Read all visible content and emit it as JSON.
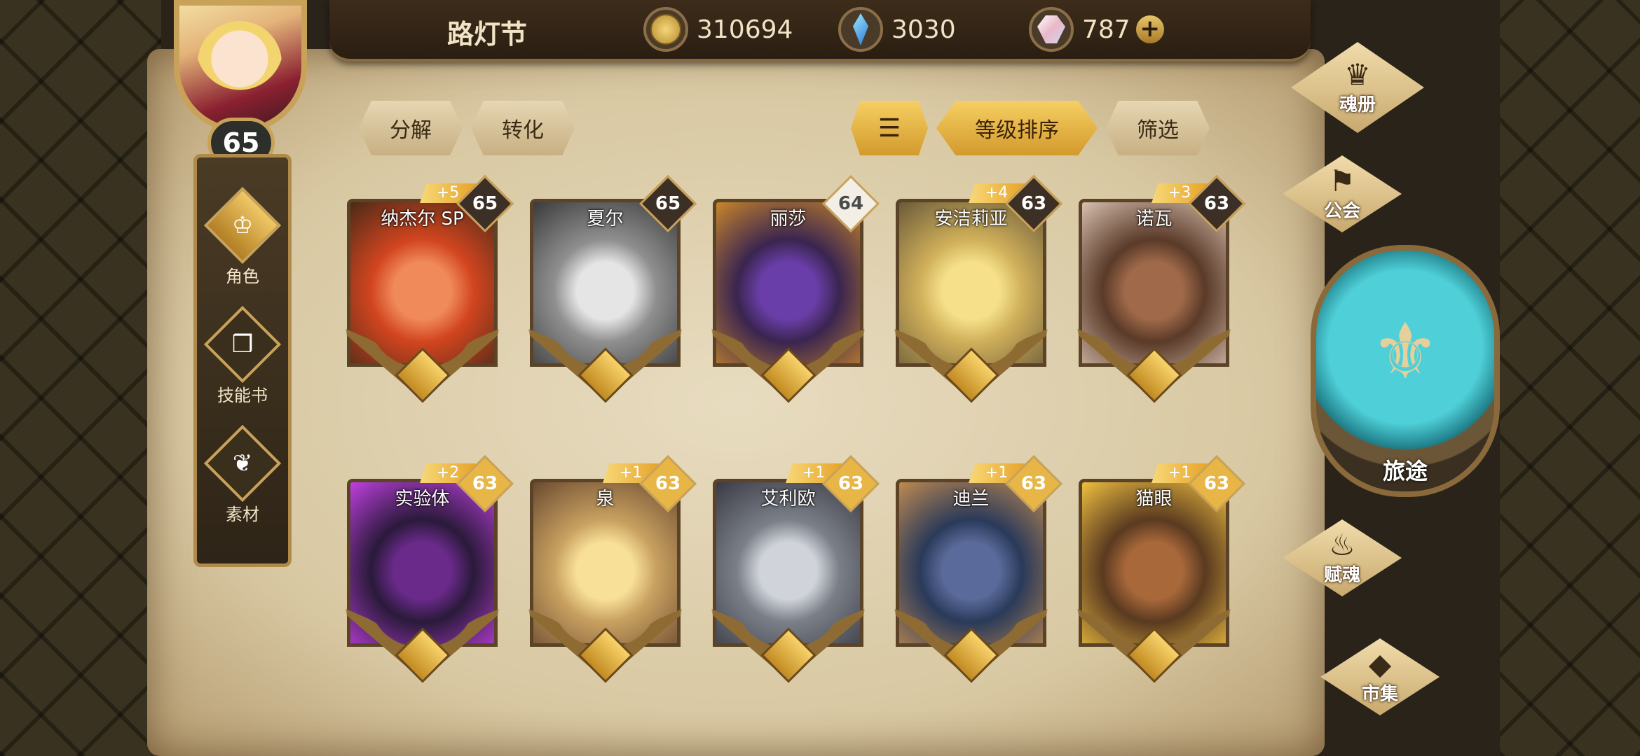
{
  "player": {
    "level": "65"
  },
  "topbar": {
    "title": "路灯节"
  },
  "resources": [
    {
      "name": "gold",
      "value": "310694",
      "icon": "gold-coin-icon"
    },
    {
      "name": "crystal",
      "value": "3030",
      "icon": "blue-crystal-icon"
    },
    {
      "name": "gem",
      "value": "787",
      "icon": "gem-icon",
      "plus": "+"
    }
  ],
  "leftnav": [
    {
      "label": "角色",
      "icon": "character-icon",
      "active": true
    },
    {
      "label": "技能书",
      "icon": "skillbook-icon"
    },
    {
      "label": "素材",
      "icon": "material-icon"
    }
  ],
  "actions": {
    "decompose": "分解",
    "convert": "转化",
    "sort": "等级排序",
    "filter": "筛选"
  },
  "cards": [
    {
      "name": "纳杰尔 SP",
      "level": "65",
      "plus": "+5"
    },
    {
      "name": "夏尔",
      "level": "65",
      "plus": ""
    },
    {
      "name": "丽莎",
      "level": "64",
      "plus": ""
    },
    {
      "name": "安洁莉亚",
      "level": "63",
      "plus": "+4"
    },
    {
      "name": "诺瓦",
      "level": "63",
      "plus": "+3"
    },
    {
      "name": "实验体",
      "level": "63",
      "plus": "+2"
    },
    {
      "name": "泉",
      "level": "63",
      "plus": "+1"
    },
    {
      "name": "艾利欧",
      "level": "63",
      "plus": "+1"
    },
    {
      "name": "迪兰",
      "level": "63",
      "plus": "+1"
    },
    {
      "name": "猫眼",
      "level": "63",
      "plus": "+1"
    }
  ],
  "rightmenu": {
    "soulbook": "魂册",
    "guild": "公会",
    "journey": "旅途",
    "endow": "赋魂",
    "market": "市集"
  }
}
